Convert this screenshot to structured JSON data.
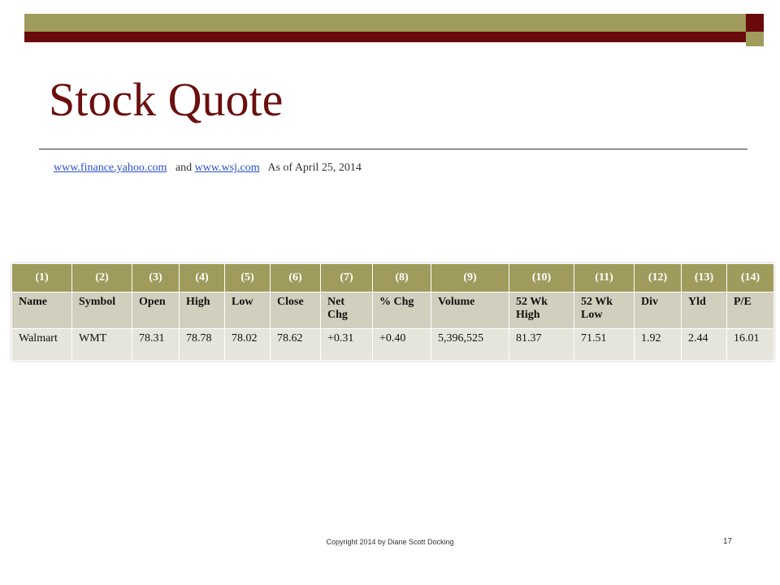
{
  "title": "Stock Quote",
  "sources": {
    "link1": "www.finance.yahoo.com",
    "connector": "and",
    "link2": "www.wsj.com",
    "as_of": "As of April 25, 2014"
  },
  "table": {
    "index_row": [
      "(1)",
      "(2)",
      "(3)",
      "(4)",
      "(5)",
      "(6)",
      "(7)",
      "(8)",
      "(9)",
      "(10)",
      "(11)",
      "(12)",
      "(13)",
      "(14)"
    ],
    "headers": [
      "Name",
      "Symbol",
      "Open",
      "High",
      "Low",
      "Close",
      "Net Chg",
      "% Chg",
      "Volume",
      "52 Wk High",
      "52 Wk Low",
      "Div",
      "Yld",
      "P/E"
    ],
    "row": [
      "Walmart",
      "WMT",
      "78.31",
      "78.78",
      "78.02",
      "78.62",
      "+0.31",
      "+0.40",
      "5,396,525",
      "81.37",
      "71.51",
      "1.92",
      "2.44",
      "16.01"
    ]
  },
  "footer": "Copyright 2014 by Diane Scott Docking",
  "page_number": "17",
  "colors": {
    "olive": "#9f9b5c",
    "maroon": "#6b0a0c",
    "title": "#6b0f0f",
    "header_bg": "#d1cfbd",
    "row_bg": "#e6e5dc"
  }
}
